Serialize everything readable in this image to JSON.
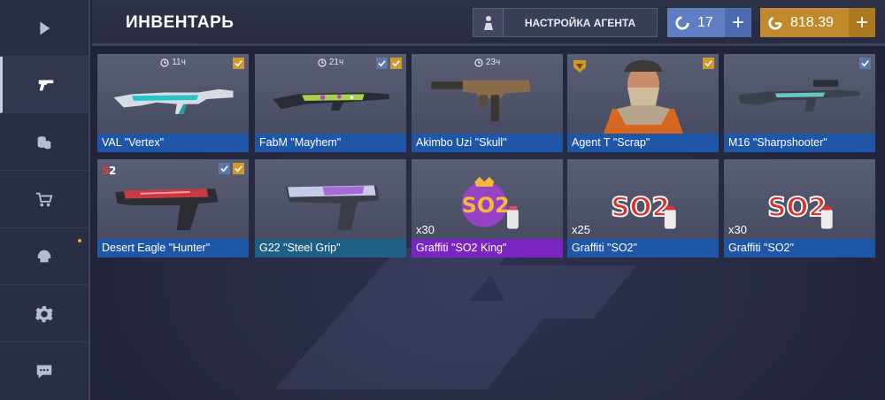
{
  "header": {
    "title": "ИНВЕНТАРЬ",
    "agent_button_label": "НАСТРОЙКА АГЕНТА",
    "credits_value": "17",
    "gold_value": "818.39",
    "plus_label": "+"
  },
  "sidebar": {
    "items": [
      {
        "icon": "play-icon"
      },
      {
        "icon": "pistol-icon",
        "active": true
      },
      {
        "icon": "coins-icon"
      },
      {
        "icon": "cart-icon"
      },
      {
        "icon": "helmet-icon",
        "notification": true
      },
      {
        "icon": "gear-icon"
      },
      {
        "icon": "chat-icon"
      }
    ]
  },
  "items": [
    {
      "name": "VAL \"Vertex\"",
      "timer": "11ч",
      "rarity": "blue",
      "checks": [
        "gold"
      ]
    },
    {
      "name": "FabM \"Mayhem\"",
      "timer": "21ч",
      "rarity": "blue",
      "checks": [
        "blue",
        "gold"
      ]
    },
    {
      "name": "Akimbo Uzi \"Skull\"",
      "timer": "23ч",
      "rarity": "blue",
      "checks": []
    },
    {
      "name": "Agent T \"Scrap\"",
      "timer": "",
      "rarity": "blue",
      "checks": [
        "gold"
      ]
    },
    {
      "name": "M16 \"Sharpshooter\"",
      "timer": "",
      "rarity": "blue",
      "checks": [
        "blue"
      ]
    },
    {
      "name": "Desert Eagle \"Hunter\"",
      "timer": "",
      "rarity": "blue",
      "checks": [
        "blue",
        "gold"
      ]
    },
    {
      "name": "G22 \"Steel Grip\"",
      "timer": "",
      "rarity": "teal",
      "checks": []
    },
    {
      "name": "Graffiti \"SO2 King\"",
      "count": "x30",
      "rarity": "purple",
      "checks": []
    },
    {
      "name": "Graffiti \"SO2\"",
      "count": "x25",
      "rarity": "blue",
      "checks": []
    },
    {
      "name": "Graffiti \"SO2\"",
      "count": "x30",
      "rarity": "blue",
      "checks": []
    }
  ],
  "colors": {
    "accent_gold": "#d09a2a",
    "credits_blue": "#5f7fc2",
    "rarity_blue": "#1e56a8",
    "rarity_purple": "#7a24c2"
  }
}
